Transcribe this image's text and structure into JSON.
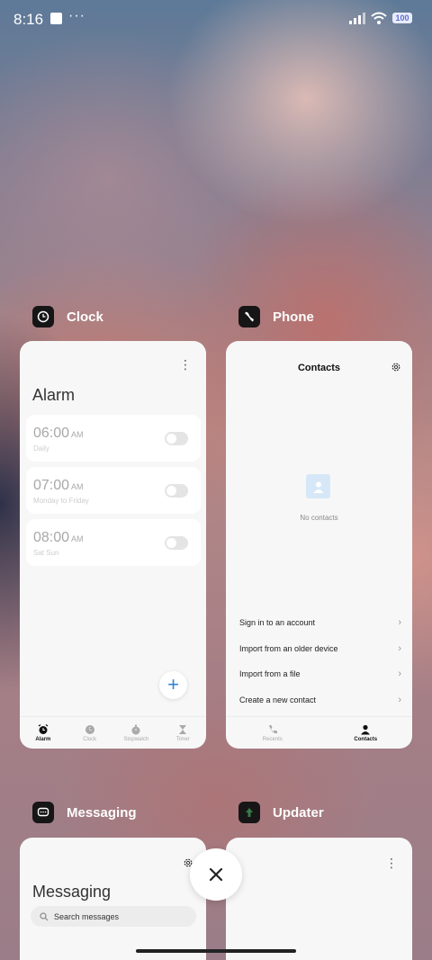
{
  "status_bar": {
    "time": "8:16",
    "more": "···",
    "battery": "100"
  },
  "apps": [
    {
      "name": "Clock"
    },
    {
      "name": "Phone"
    },
    {
      "name": "Messaging"
    },
    {
      "name": "Updater"
    }
  ],
  "clock": {
    "menu_icon": "more-vertical-icon",
    "title": "Alarm",
    "alarms": [
      {
        "time": "06:00",
        "ampm": "AM",
        "repeat": "Daily",
        "enabled": false
      },
      {
        "time": "07:00",
        "ampm": "AM",
        "repeat": "Monday to Friday",
        "enabled": false
      },
      {
        "time": "08:00",
        "ampm": "AM",
        "repeat": "Sat Sun",
        "enabled": false
      }
    ],
    "add_label": "+",
    "nav": [
      {
        "label": "Alarm",
        "icon": "alarm-clock-icon",
        "active": true
      },
      {
        "label": "Clock",
        "icon": "clock-icon",
        "active": false
      },
      {
        "label": "Stopwatch",
        "icon": "stopwatch-icon",
        "active": false
      },
      {
        "label": "Timer",
        "icon": "hourglass-icon",
        "active": false
      }
    ]
  },
  "phone": {
    "title": "Contacts",
    "empty_text": "No contacts",
    "options": [
      {
        "label": "Sign in to an account"
      },
      {
        "label": "Import from an older device"
      },
      {
        "label": "Import from a file"
      },
      {
        "label": "Create a new contact"
      }
    ],
    "nav": [
      {
        "label": "Recents",
        "icon": "phone-icon",
        "active": false
      },
      {
        "label": "Contacts",
        "icon": "person-icon",
        "active": true
      }
    ]
  },
  "messaging": {
    "title": "Messaging",
    "search_placeholder": "Search messages"
  },
  "close_icon": "close-icon"
}
